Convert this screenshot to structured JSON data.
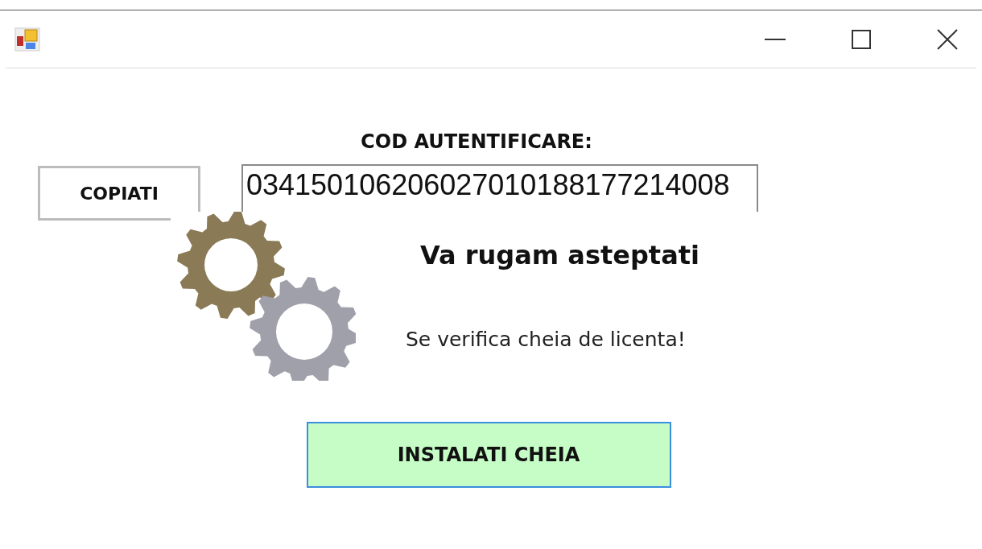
{
  "form": {
    "heading": "COD AUTENTIFICARE:",
    "copy_button": "COPIATI",
    "auth_code": "034150106206027010188177214008",
    "install_button": "INSTALATI CHEIA"
  },
  "overlay": {
    "title": "Va rugam asteptati",
    "message": "Se verifica cheia de licenta!"
  }
}
